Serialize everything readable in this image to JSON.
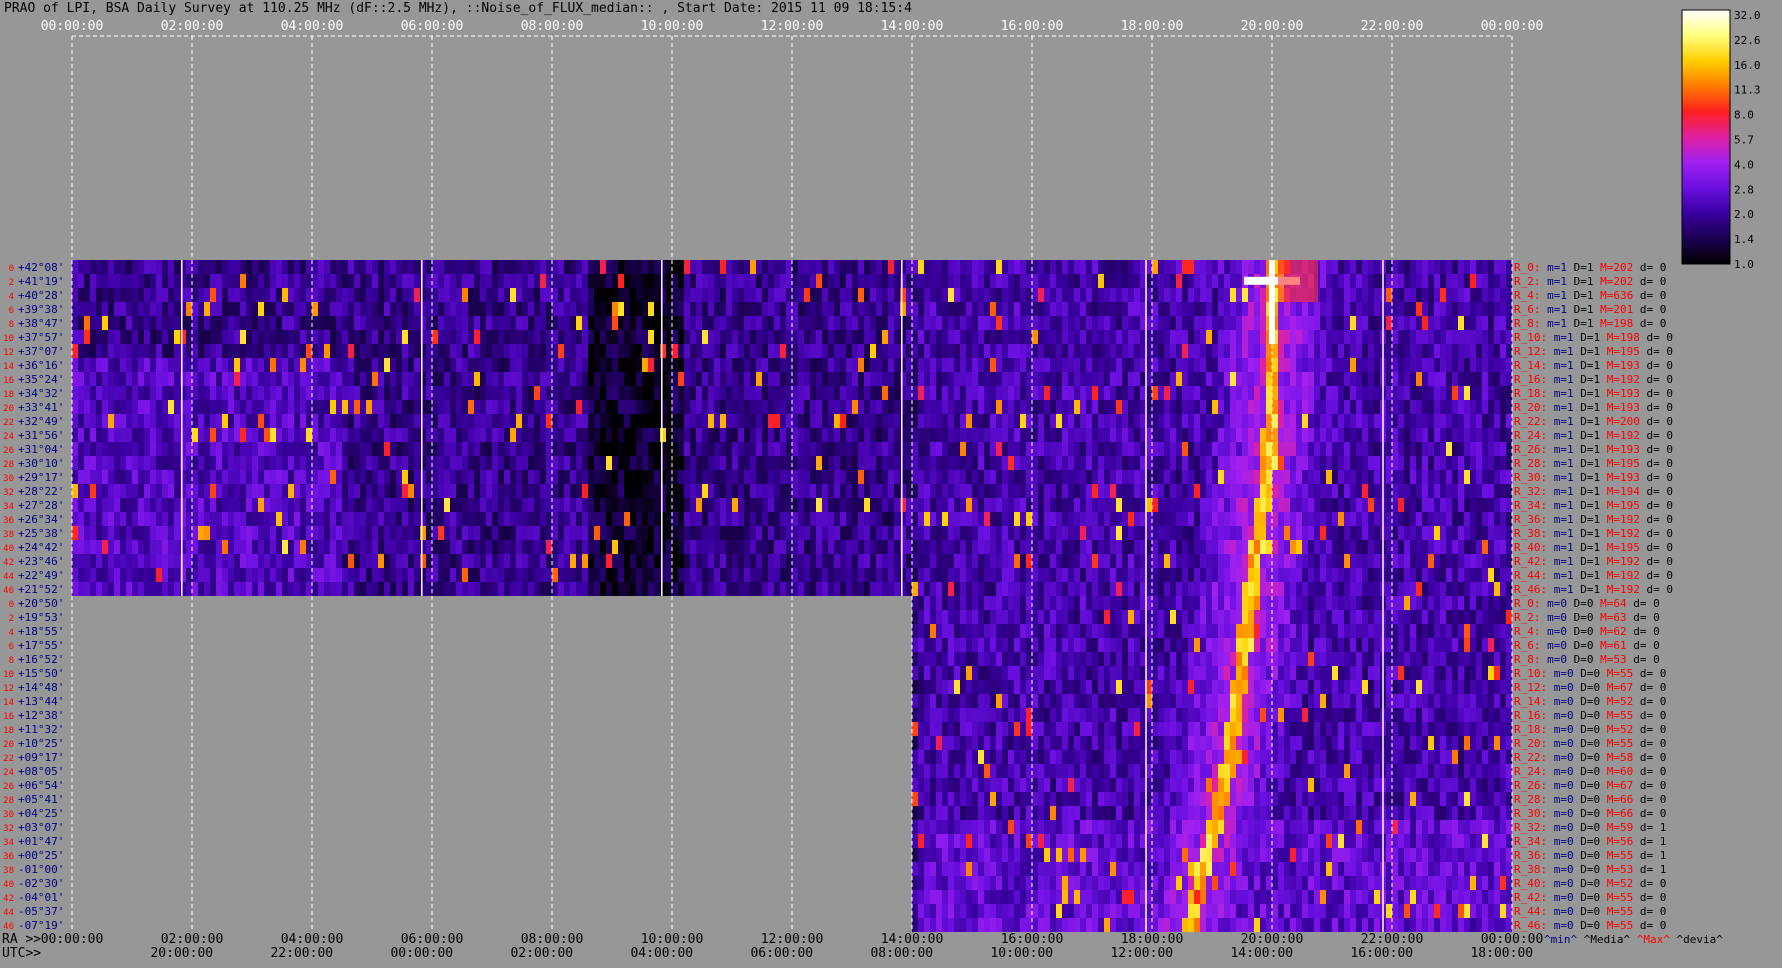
{
  "title": "PRAO of LPI, BSA Daily Survey at 110.25 MHz (dF::2.5 MHz), ::Noise_of_FLUX_median:: , Start Date: 2015 11 09 18:15:4",
  "colors": {
    "background": "#979797",
    "gridline": "#ffffff",
    "label_red": "#ff0000",
    "label_navy": "#000080",
    "text": "#000000"
  },
  "chart_data": {
    "type": "heatmap",
    "title": "PRAO of LPI, BSA Daily Survey at 110.25 MHz (dF::2.5 MHz), ::Noise_of_FLUX_median:: , Start Date: 2015 11 09 18:15:4",
    "top_axis_ticks": [
      "00:00:00",
      "02:00:00",
      "04:00:00",
      "06:00:00",
      "08:00:00",
      "10:00:00",
      "12:00:00",
      "14:00:00",
      "16:00:00",
      "18:00:00",
      "20:00:00",
      "22:00:00",
      "00:00:00"
    ],
    "bottom_axis_prefix_ra": "RA >>",
    "bottom_axis_prefix_utc": "UTC>>",
    "bottom_ra_ticks": [
      "00:00:00",
      "02:00:00",
      "04:00:00",
      "06:00:00",
      "08:00:00",
      "10:00:00",
      "12:00:00",
      "14:00:00",
      "16:00:00",
      "18:00:00",
      "20:00:00",
      "22:00:00",
      "00:00:00"
    ],
    "bottom_utc_ticks": [
      "20:00:00",
      "22:00:00",
      "00:00:00",
      "02:00:00",
      "04:00:00",
      "06:00:00",
      "08:00:00",
      "10:00:00",
      "12:00:00",
      "14:00:00",
      "16:00:00",
      "18:00:00"
    ],
    "x_range_hours": [
      0,
      24
    ],
    "declinations": [
      "+42°08'",
      "+41°19'",
      "+40°28'",
      "+39°38'",
      "+38°47'",
      "+37°57'",
      "+37°07'",
      "+36°16'",
      "+35°24'",
      "+34°32'",
      "+33°41'",
      "+32°49'",
      "+31°56'",
      "+31°04'",
      "+30°10'",
      "+29°17'",
      "+28°22'",
      "+27°28'",
      "+26°34'",
      "+25°38'",
      "+24°42'",
      "+23°46'",
      "+22°49'",
      "+21°52'",
      "+20°50'",
      "+19°53'",
      "+18°55'",
      "+17°55'",
      "+16°52'",
      "+15°50'",
      "+14°48'",
      "+13°44'",
      "+12°38'",
      "+11°32'",
      "+10°25'",
      "+09°17'",
      "+08°05'",
      "+06°54'",
      "+05°41'",
      "+04°25'",
      "+03°07'",
      "+01°47'",
      "+00°25'",
      "-01°00'",
      "-02°30'",
      "-04°01'",
      "-05°37'",
      "-07°19'"
    ],
    "row_numbers_left": [
      "0",
      "2",
      "4",
      "6",
      "8",
      "10",
      "12",
      "14",
      "16",
      "18",
      "20",
      "22",
      "24",
      "26",
      "28",
      "30",
      "32",
      "34",
      "36",
      "38",
      "40",
      "42",
      "44",
      "46",
      "0",
      "2",
      "4",
      "6",
      "8",
      "10",
      "12",
      "14",
      "16",
      "18",
      "20",
      "22",
      "24",
      "26",
      "28",
      "30",
      "32",
      "34",
      "36",
      "38",
      "40",
      "42",
      "44",
      "46"
    ],
    "row_stats": [
      {
        "label": "R_0:",
        "m": "m=1",
        "d": "D=1",
        "max": "M=202",
        "dev": "d= 0"
      },
      {
        "label": "R_2:",
        "m": "m=1",
        "d": "D=1",
        "max": "M=202",
        "dev": "d= 0"
      },
      {
        "label": "R_4:",
        "m": "m=1",
        "d": "D=1",
        "max": "M=636",
        "dev": "d= 0"
      },
      {
        "label": "R_6:",
        "m": "m=1",
        "d": "D=1",
        "max": "M=201",
        "dev": "d= 0"
      },
      {
        "label": "R_8:",
        "m": "m=1",
        "d": "D=1",
        "max": "M=198",
        "dev": "d= 0"
      },
      {
        "label": "R_10:",
        "m": "m=1",
        "d": "D=1",
        "max": "M=198",
        "dev": "d= 0"
      },
      {
        "label": "R_12:",
        "m": "m=1",
        "d": "D=1",
        "max": "M=195",
        "dev": "d= 0"
      },
      {
        "label": "R_14:",
        "m": "m=1",
        "d": "D=1",
        "max": "M=193",
        "dev": "d= 0"
      },
      {
        "label": "R_16:",
        "m": "m=1",
        "d": "D=1",
        "max": "M=192",
        "dev": "d= 0"
      },
      {
        "label": "R_18:",
        "m": "m=1",
        "d": "D=1",
        "max": "M=193",
        "dev": "d= 0"
      },
      {
        "label": "R_20:",
        "m": "m=1",
        "d": "D=1",
        "max": "M=193",
        "dev": "d= 0"
      },
      {
        "label": "R_22:",
        "m": "m=1",
        "d": "D=1",
        "max": "M=200",
        "dev": "d= 0"
      },
      {
        "label": "R_24:",
        "m": "m=1",
        "d": "D=1",
        "max": "M=192",
        "dev": "d= 0"
      },
      {
        "label": "R_26:",
        "m": "m=1",
        "d": "D=1",
        "max": "M=193",
        "dev": "d= 0"
      },
      {
        "label": "R_28:",
        "m": "m=1",
        "d": "D=1",
        "max": "M=195",
        "dev": "d= 0"
      },
      {
        "label": "R_30:",
        "m": "m=1",
        "d": "D=1",
        "max": "M=193",
        "dev": "d= 0"
      },
      {
        "label": "R_32:",
        "m": "m=1",
        "d": "D=1",
        "max": "M=194",
        "dev": "d= 0"
      },
      {
        "label": "R_34:",
        "m": "m=1",
        "d": "D=1",
        "max": "M=195",
        "dev": "d= 0"
      },
      {
        "label": "R_36:",
        "m": "m=1",
        "d": "D=1",
        "max": "M=192",
        "dev": "d= 0"
      },
      {
        "label": "R_38:",
        "m": "m=1",
        "d": "D=1",
        "max": "M=192",
        "dev": "d= 0"
      },
      {
        "label": "R_40:",
        "m": "m=1",
        "d": "D=1",
        "max": "M=195",
        "dev": "d= 0"
      },
      {
        "label": "R_42:",
        "m": "m=1",
        "d": "D=1",
        "max": "M=192",
        "dev": "d= 0"
      },
      {
        "label": "R_44:",
        "m": "m=1",
        "d": "D=1",
        "max": "M=192",
        "dev": "d= 0"
      },
      {
        "label": "R_46:",
        "m": "m=1",
        "d": "D=1",
        "max": "M=192",
        "dev": "d= 0"
      },
      {
        "label": "R_0:",
        "m": "m=0",
        "d": "D=0",
        "max": "M=64",
        "dev": "d= 0"
      },
      {
        "label": "R_2:",
        "m": "m=0",
        "d": "D=0",
        "max": "M=63",
        "dev": "d= 0"
      },
      {
        "label": "R_4:",
        "m": "m=0",
        "d": "D=0",
        "max": "M=62",
        "dev": "d= 0"
      },
      {
        "label": "R_6:",
        "m": "m=0",
        "d": "D=0",
        "max": "M=61",
        "dev": "d= 0"
      },
      {
        "label": "R_8:",
        "m": "m=0",
        "d": "D=0",
        "max": "M=53",
        "dev": "d= 0"
      },
      {
        "label": "R_10:",
        "m": "m=0",
        "d": "D=0",
        "max": "M=55",
        "dev": "d= 0"
      },
      {
        "label": "R_12:",
        "m": "m=0",
        "d": "D=0",
        "max": "M=67",
        "dev": "d= 0"
      },
      {
        "label": "R_14:",
        "m": "m=0",
        "d": "D=0",
        "max": "M=52",
        "dev": "d= 0"
      },
      {
        "label": "R_16:",
        "m": "m=0",
        "d": "D=0",
        "max": "M=55",
        "dev": "d= 0"
      },
      {
        "label": "R_18:",
        "m": "m=0",
        "d": "D=0",
        "max": "M=52",
        "dev": "d= 0"
      },
      {
        "label": "R_20:",
        "m": "m=0",
        "d": "D=0",
        "max": "M=55",
        "dev": "d= 0"
      },
      {
        "label": "R_22:",
        "m": "m=0",
        "d": "D=0",
        "max": "M=58",
        "dev": "d= 0"
      },
      {
        "label": "R_24:",
        "m": "m=0",
        "d": "D=0",
        "max": "M=60",
        "dev": "d= 0"
      },
      {
        "label": "R_26:",
        "m": "m=0",
        "d": "D=0",
        "max": "M=67",
        "dev": "d= 0"
      },
      {
        "label": "R_28:",
        "m": "m=0",
        "d": "D=0",
        "max": "M=66",
        "dev": "d= 0"
      },
      {
        "label": "R_30:",
        "m": "m=0",
        "d": "D=0",
        "max": "M=66",
        "dev": "d= 0"
      },
      {
        "label": "R_32:",
        "m": "m=0",
        "d": "D=0",
        "max": "M=59",
        "dev": "d= 1"
      },
      {
        "label": "R_34:",
        "m": "m=0",
        "d": "D=0",
        "max": "M=56",
        "dev": "d= 1"
      },
      {
        "label": "R_36:",
        "m": "m=0",
        "d": "D=0",
        "max": "M=55",
        "dev": "d= 1"
      },
      {
        "label": "R_38:",
        "m": "m=0",
        "d": "D=0",
        "max": "M=53",
        "dev": "d= 1"
      },
      {
        "label": "R_40:",
        "m": "m=0",
        "d": "D=0",
        "max": "M=52",
        "dev": "d= 0"
      },
      {
        "label": "R_42:",
        "m": "m=0",
        "d": "D=0",
        "max": "M=55",
        "dev": "d= 0"
      },
      {
        "label": "R_44:",
        "m": "m=0",
        "d": "D=0",
        "max": "M=55",
        "dev": "d= 0"
      },
      {
        "label": "R_46:",
        "m": "m=0",
        "d": "D=0",
        "max": "M=55",
        "dev": "d= 0"
      }
    ],
    "stats_legend": [
      "^min^",
      "^Media^",
      "^Max^",
      "^devia^"
    ],
    "colorbar_ticks": [
      "32.0",
      "22.6",
      "16.0",
      "11.3",
      "8.0",
      "5.7",
      "4.0",
      "2.8",
      "2.0",
      "1.4",
      "1.0"
    ],
    "colorbar_range": [
      1.0,
      32.0
    ],
    "colorbar_scale": "log",
    "colormap": [
      "#000000",
      "#1a0050",
      "#3a00a0",
      "#6a10e0",
      "#a020f0",
      "#e020a0",
      "#ff2020",
      "#ff7a00",
      "#ffd000",
      "#ffff80",
      "#ffffff"
    ],
    "data_extent_rows": {
      "upper_block_rows": 24,
      "lower_block_start_hour": 14.0
    },
    "solid_lines_hours": [
      1.83,
      5.83,
      9.83,
      13.83,
      17.9,
      21.85
    ],
    "source_track_hours": {
      "bright_source_hour": 20.0,
      "diagonal_source": [
        [
          18.6,
          47
        ],
        [
          19.2,
          36
        ],
        [
          19.9,
          14
        ],
        [
          20.0,
          0
        ]
      ]
    }
  }
}
